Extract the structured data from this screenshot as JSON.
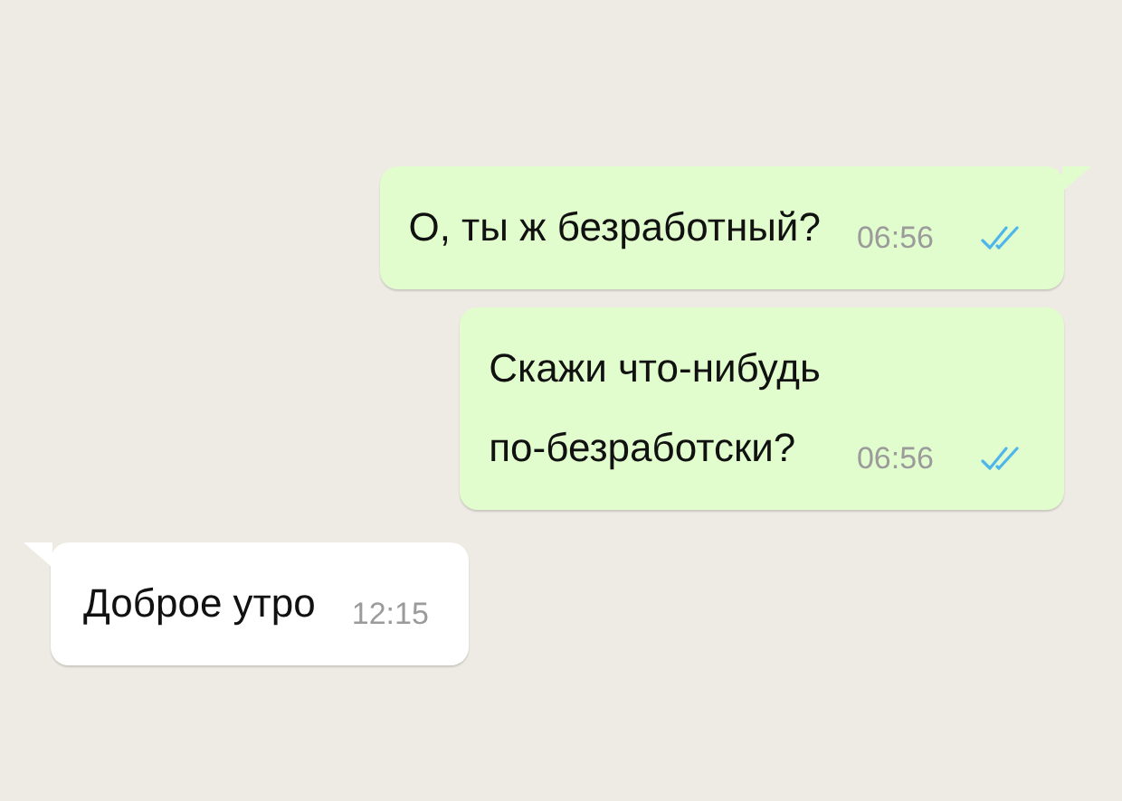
{
  "messages": [
    {
      "kind": "outgoing",
      "text": "О, ты ж безработный?",
      "time": "06:56",
      "ticks": true,
      "tail": true
    },
    {
      "kind": "outgoing",
      "text": "Скажи что-нибудь\nпо-безработски?",
      "time": "06:56",
      "ticks": true,
      "tail": false
    },
    {
      "kind": "incoming",
      "text": "Доброе утро",
      "time": "12:15",
      "ticks": false,
      "tail": true
    }
  ]
}
